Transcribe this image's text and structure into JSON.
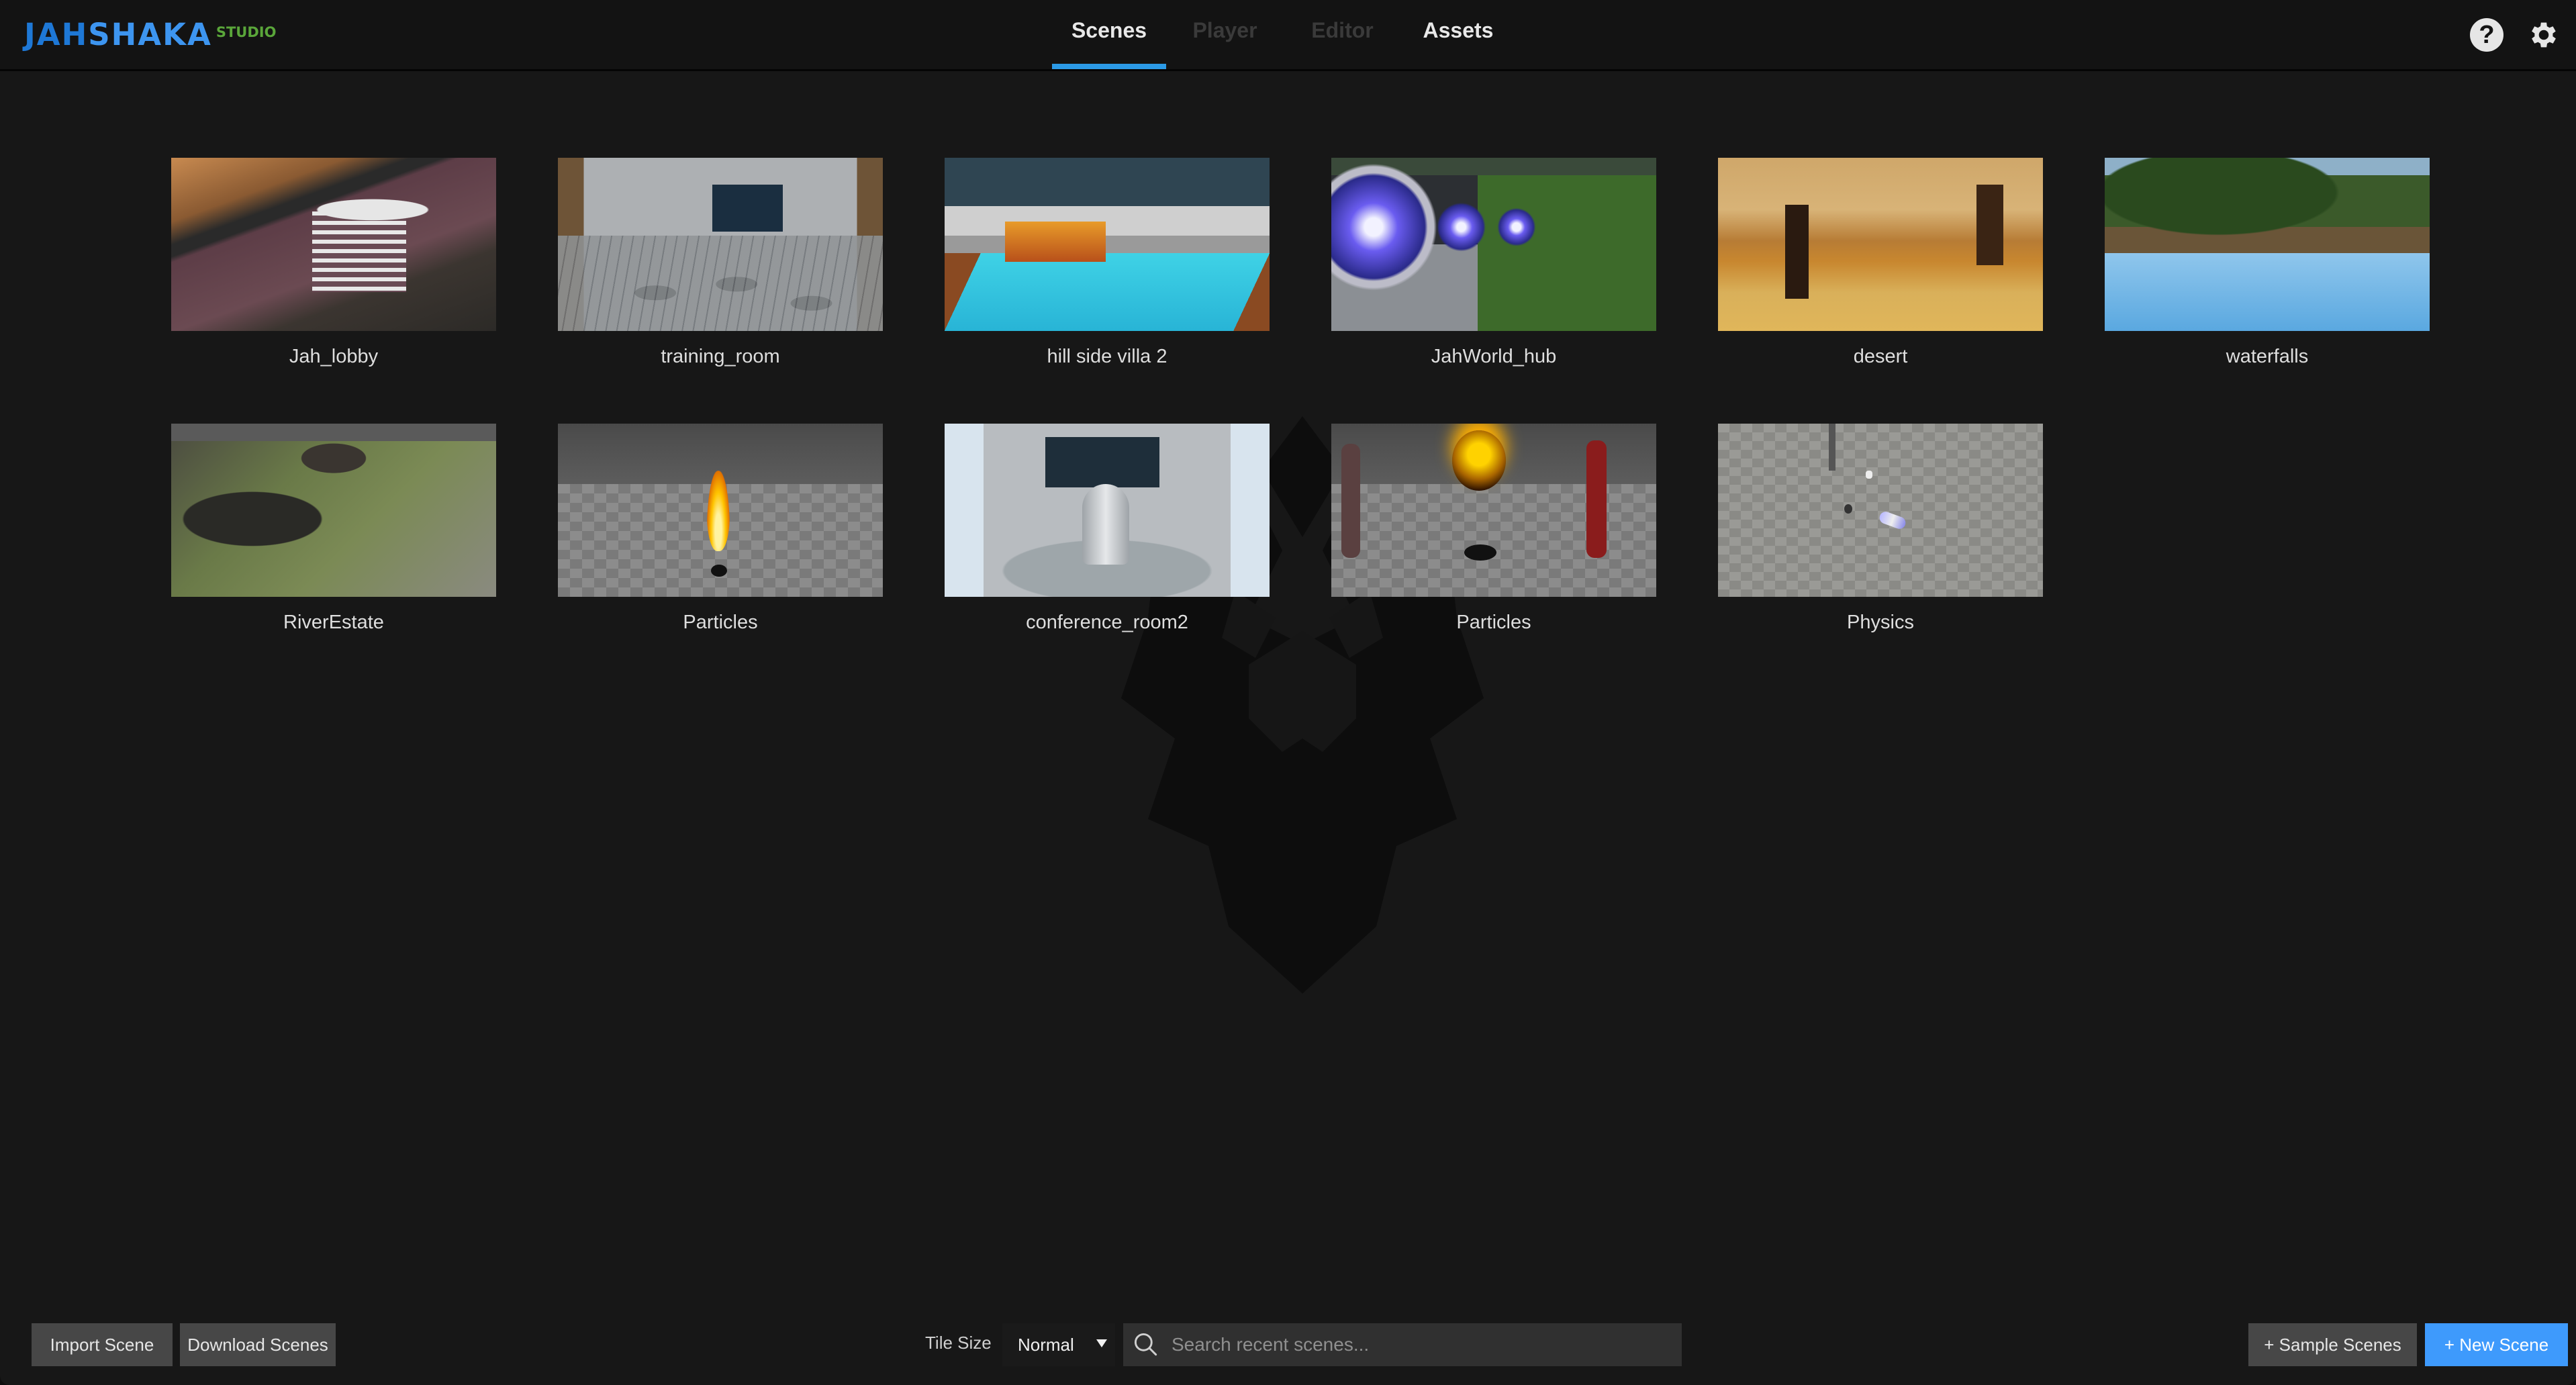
{
  "app": {
    "logo": {
      "part1": "JAH",
      "part2": "SHAKA",
      "suffix": "STUDIO"
    },
    "colors": {
      "accent": "#2b9ae6",
      "primary_button": "#3e9afc",
      "logo_blue": "#3d95f0",
      "logo_green": "#5aa63a"
    }
  },
  "header": {
    "tabs": [
      {
        "label": "Scenes",
        "active": true,
        "enabled": true
      },
      {
        "label": "Player",
        "active": false,
        "enabled": false
      },
      {
        "label": "Editor",
        "active": false,
        "enabled": false
      },
      {
        "label": "Assets",
        "active": false,
        "enabled": true
      }
    ],
    "icons": {
      "help": "?",
      "settings": "gear-icon"
    }
  },
  "scenes": [
    {
      "name": "Jah_lobby",
      "thumb": "lobby"
    },
    {
      "name": "training_room",
      "thumb": "training"
    },
    {
      "name": "hill side villa 2",
      "thumb": "villa"
    },
    {
      "name": "JahWorld_hub",
      "thumb": "hub"
    },
    {
      "name": "desert",
      "thumb": "desert"
    },
    {
      "name": "waterfalls",
      "thumb": "waterfalls"
    },
    {
      "name": "RiverEstate",
      "thumb": "river"
    },
    {
      "name": "Particles",
      "thumb": "particles1"
    },
    {
      "name": "conference_room2",
      "thumb": "conference"
    },
    {
      "name": "Particles",
      "thumb": "particles2"
    },
    {
      "name": "Physics",
      "thumb": "physics"
    }
  ],
  "footer": {
    "import_label": "Import Scene",
    "download_label": "Download Scenes",
    "tile_size_label": "Tile Size",
    "tile_size_value": "Normal",
    "search_placeholder": "Search recent scenes...",
    "search_value": "",
    "sample_label": "+ Sample Scenes",
    "new_label": "+ New Scene"
  }
}
